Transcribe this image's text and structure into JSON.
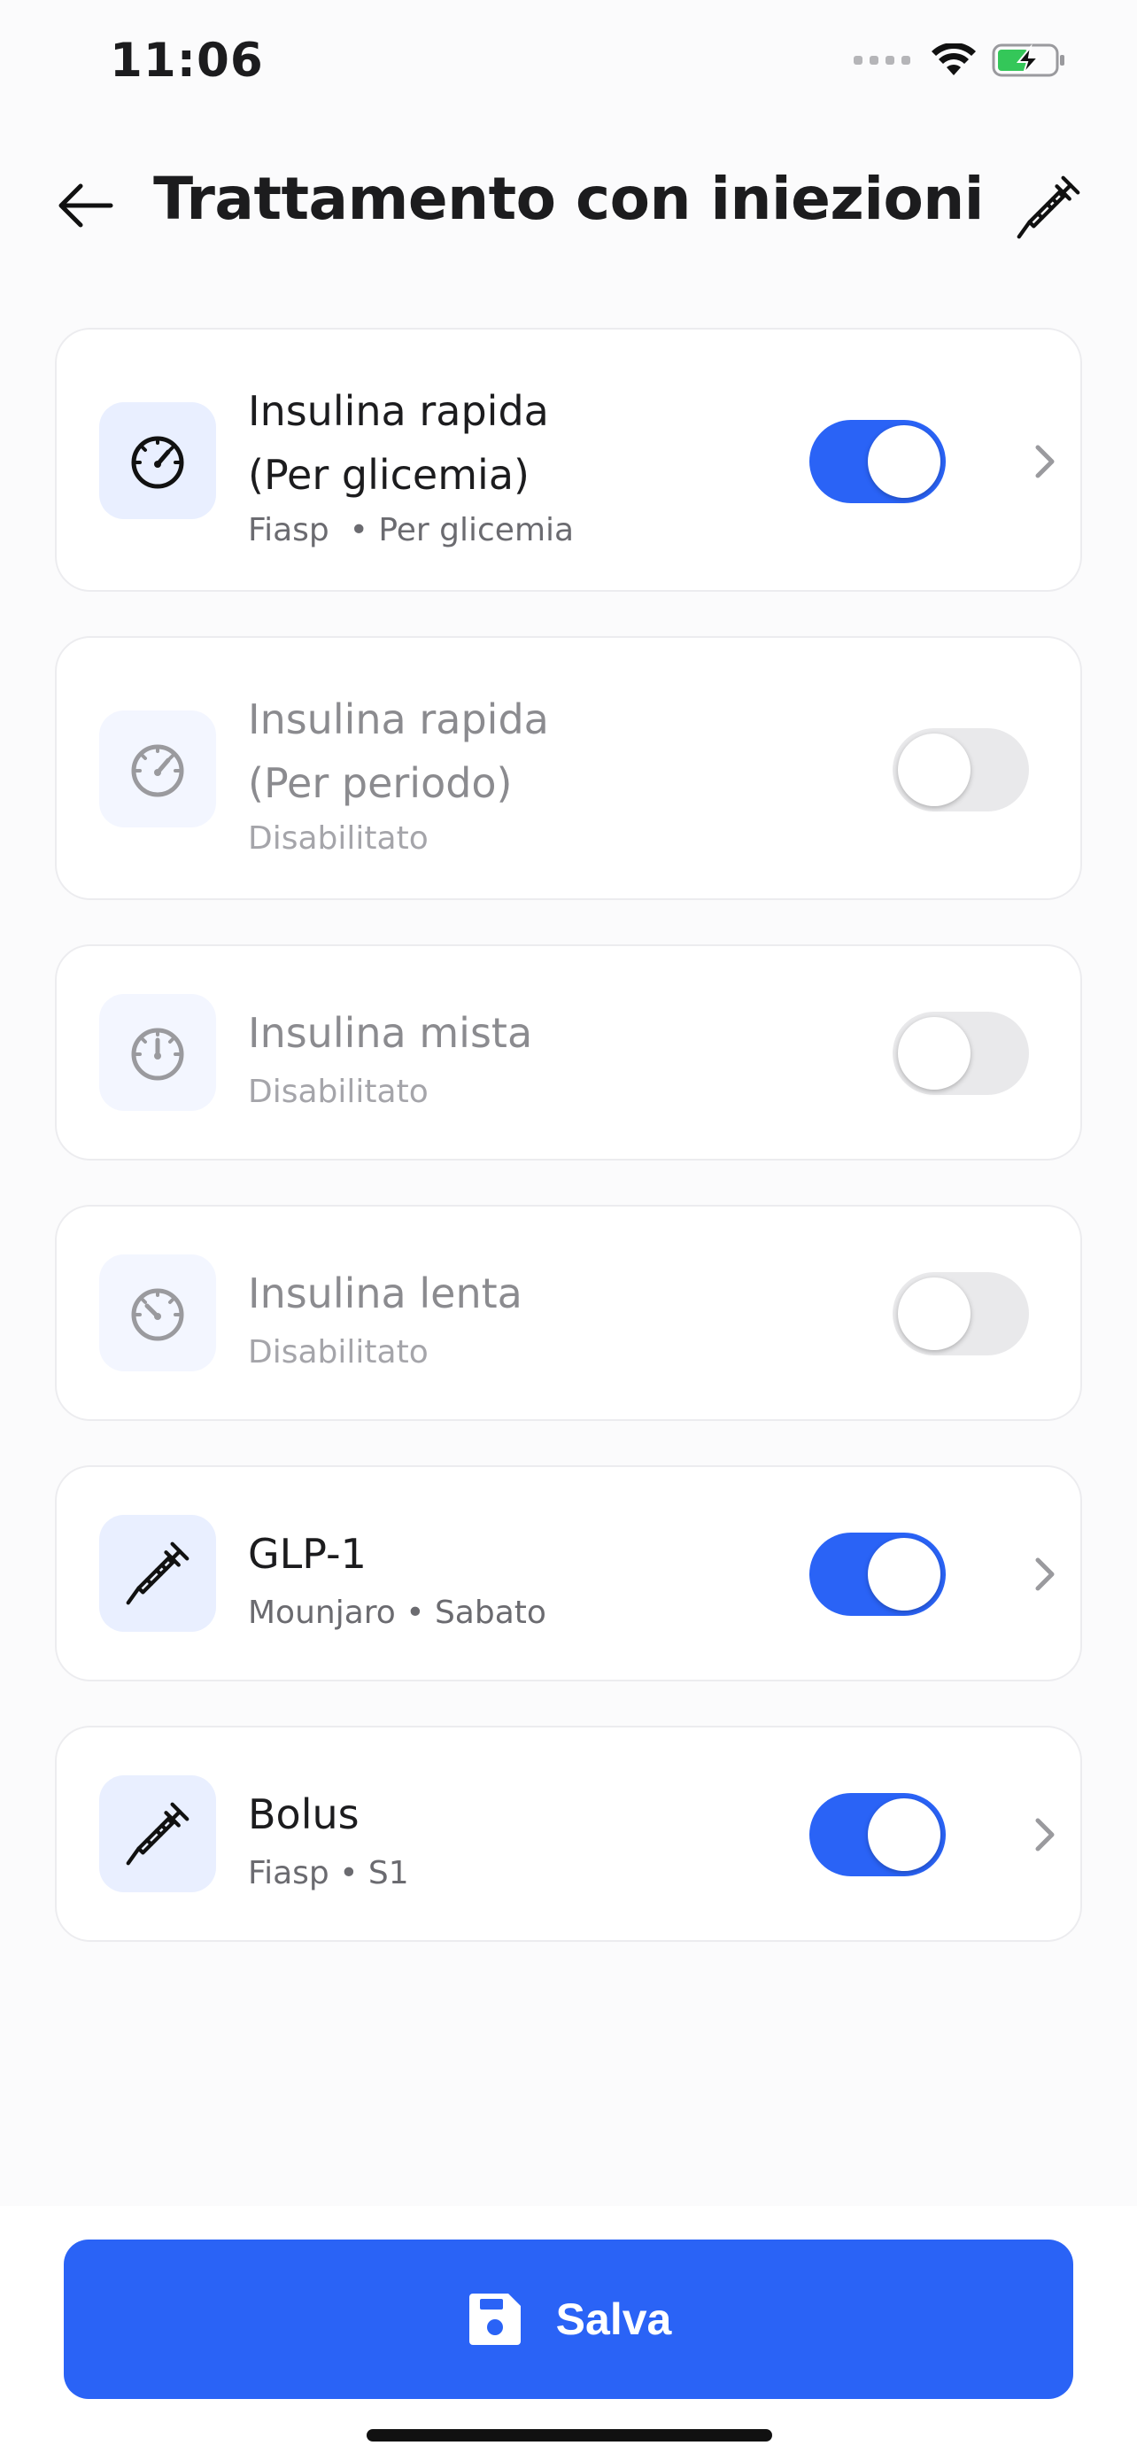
{
  "status_bar": {
    "time": "11:06"
  },
  "header": {
    "title": "Trattamento con iniezioni"
  },
  "cards": [
    {
      "title_line1": "Insulina rapida",
      "title_line2": "(Per glicemia)",
      "subtitle": "Fiasp  • Per glicemia",
      "enabled": true,
      "icon": "gauge-icon"
    },
    {
      "title_line1": "Insulina rapida",
      "title_line2": "(Per periodo)",
      "subtitle": "Disabilitato",
      "enabled": false,
      "icon": "gauge-icon"
    },
    {
      "title_line1": "Insulina mista",
      "subtitle": "Disabilitato",
      "enabled": false,
      "icon": "gauge-icon"
    },
    {
      "title_line1": "Insulina lenta",
      "subtitle": "Disabilitato",
      "enabled": false,
      "icon": "gauge-icon"
    },
    {
      "title_line1": "GLP-1",
      "subtitle": "Mounjaro • Sabato",
      "enabled": true,
      "icon": "syringe-icon"
    },
    {
      "title_line1": "Bolus",
      "subtitle": "Fiasp • S1",
      "enabled": true,
      "icon": "syringe-icon"
    }
  ],
  "footer": {
    "save_label": "Salva"
  },
  "colors": {
    "accent": "#2a63f6",
    "icon_bg": "#e9efff",
    "battery_green": "#34c759"
  }
}
